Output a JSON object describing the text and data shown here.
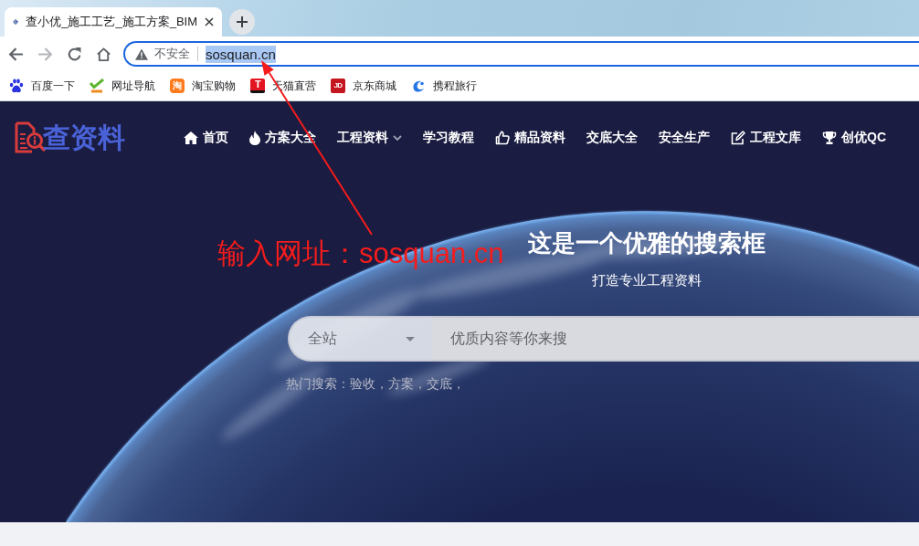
{
  "browser": {
    "tab": {
      "title": "查小优_施工工艺_施工方案_BIM",
      "selected": true
    },
    "nav_buttons": [
      {
        "disabled": false
      },
      {
        "disabled": true
      },
      {
        "disabled": false
      },
      {
        "disabled": false
      }
    ],
    "address_bar": {
      "security_label": "不安全",
      "url": "sosquan.cn",
      "url_selected": true,
      "focused": true
    },
    "bookmarks": [
      {
        "label": "百度一下"
      },
      {
        "label": "网址导航"
      },
      {
        "label": "淘宝购物",
        "logo_text": "淘"
      },
      {
        "label": "天猫直营",
        "logo_text": "T"
      },
      {
        "label": "京东商城",
        "logo_text": "JD"
      },
      {
        "label": "携程旅行"
      }
    ]
  },
  "site": {
    "logo": "查资料",
    "nav": [
      {
        "label": "首页",
        "kind": "link"
      },
      {
        "label": "方案大全",
        "kind": "link"
      },
      {
        "label": "工程资料",
        "kind": "dropdown"
      },
      {
        "label": "学习教程",
        "kind": "link"
      },
      {
        "label": "精品资料",
        "kind": "link"
      },
      {
        "label": "交底大全",
        "kind": "link"
      },
      {
        "label": "安全生产",
        "kind": "link"
      },
      {
        "label": "工程文库",
        "kind": "link"
      },
      {
        "label": "创优QC",
        "kind": "link"
      }
    ],
    "hero": {
      "title": "这是一个优雅的搜索框",
      "subtitle": "打造专业工程资料"
    },
    "search": {
      "scope": "全站",
      "placeholder": "优质内容等你来搜"
    },
    "hot_searches": {
      "label": "热门搜索：",
      "terms": [
        "验收，",
        "方案，",
        "交底，"
      ]
    }
  },
  "annotation": {
    "text": "输入网址：sosquan.cn"
  }
}
